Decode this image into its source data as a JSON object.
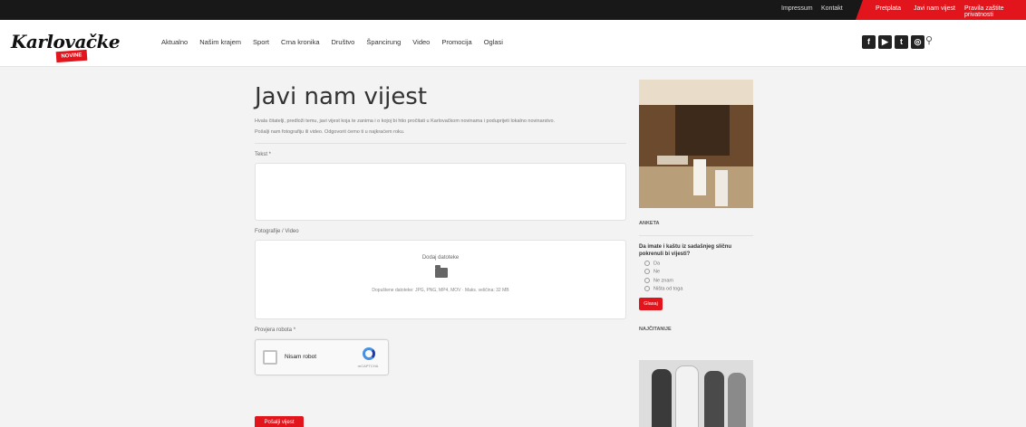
{
  "topbar": {
    "links": [
      "Impressum",
      "Kontakt"
    ],
    "red_links": [
      "Pretplata",
      "Javi nam vijest",
      "Pravila zaštite privatnosti"
    ]
  },
  "header": {
    "logo": "Karlovačke",
    "logo_badge": "NOVINE",
    "nav": [
      "Aktualno",
      "Našim krajem",
      "Sport",
      "Crna kronika",
      "Društvo",
      "Špancirung",
      "Video",
      "Promocija",
      "Oglasi"
    ],
    "social_icons": [
      "facebook-icon",
      "youtube-icon",
      "twitter-icon",
      "instagram-icon"
    ]
  },
  "form": {
    "title": "Javi nam vijest",
    "intro1": "Hvala čitatelji, predloži temu, javi vijest koja te zanima i o kojoj bi htio pročitati u Karlovačkom novinama i poduprijeti lokalno novinarstvo.",
    "intro2": "Pošalji nam fotografiju ili video. Odgovorit ćemo ti u najkraćem roku.",
    "text_label": "Tekst *",
    "media_label": "Fotografije / Video",
    "upload_title": "Dodaj datoteke",
    "upload_note": "Dopuštene datoteke: JPG, PNG, MP4, MOV · Maks. veličina: 32 MB",
    "captcha_label": "Provjera robota *",
    "captcha_text": "Nisam robot",
    "captcha_brand": "reCAPTCHA",
    "submit": "Pošalji vijest"
  },
  "sidebar": {
    "poll_label": "ANKETA",
    "poll_question": "Da imate i kaštu iz sadašnjeg sličnu pokrenuli bi vijesti?",
    "options": [
      "Da",
      "Ne",
      "Ne znam",
      "Ništa od toga"
    ],
    "vote": "Glasaj",
    "latest_label": "NAJČITANIJE"
  }
}
